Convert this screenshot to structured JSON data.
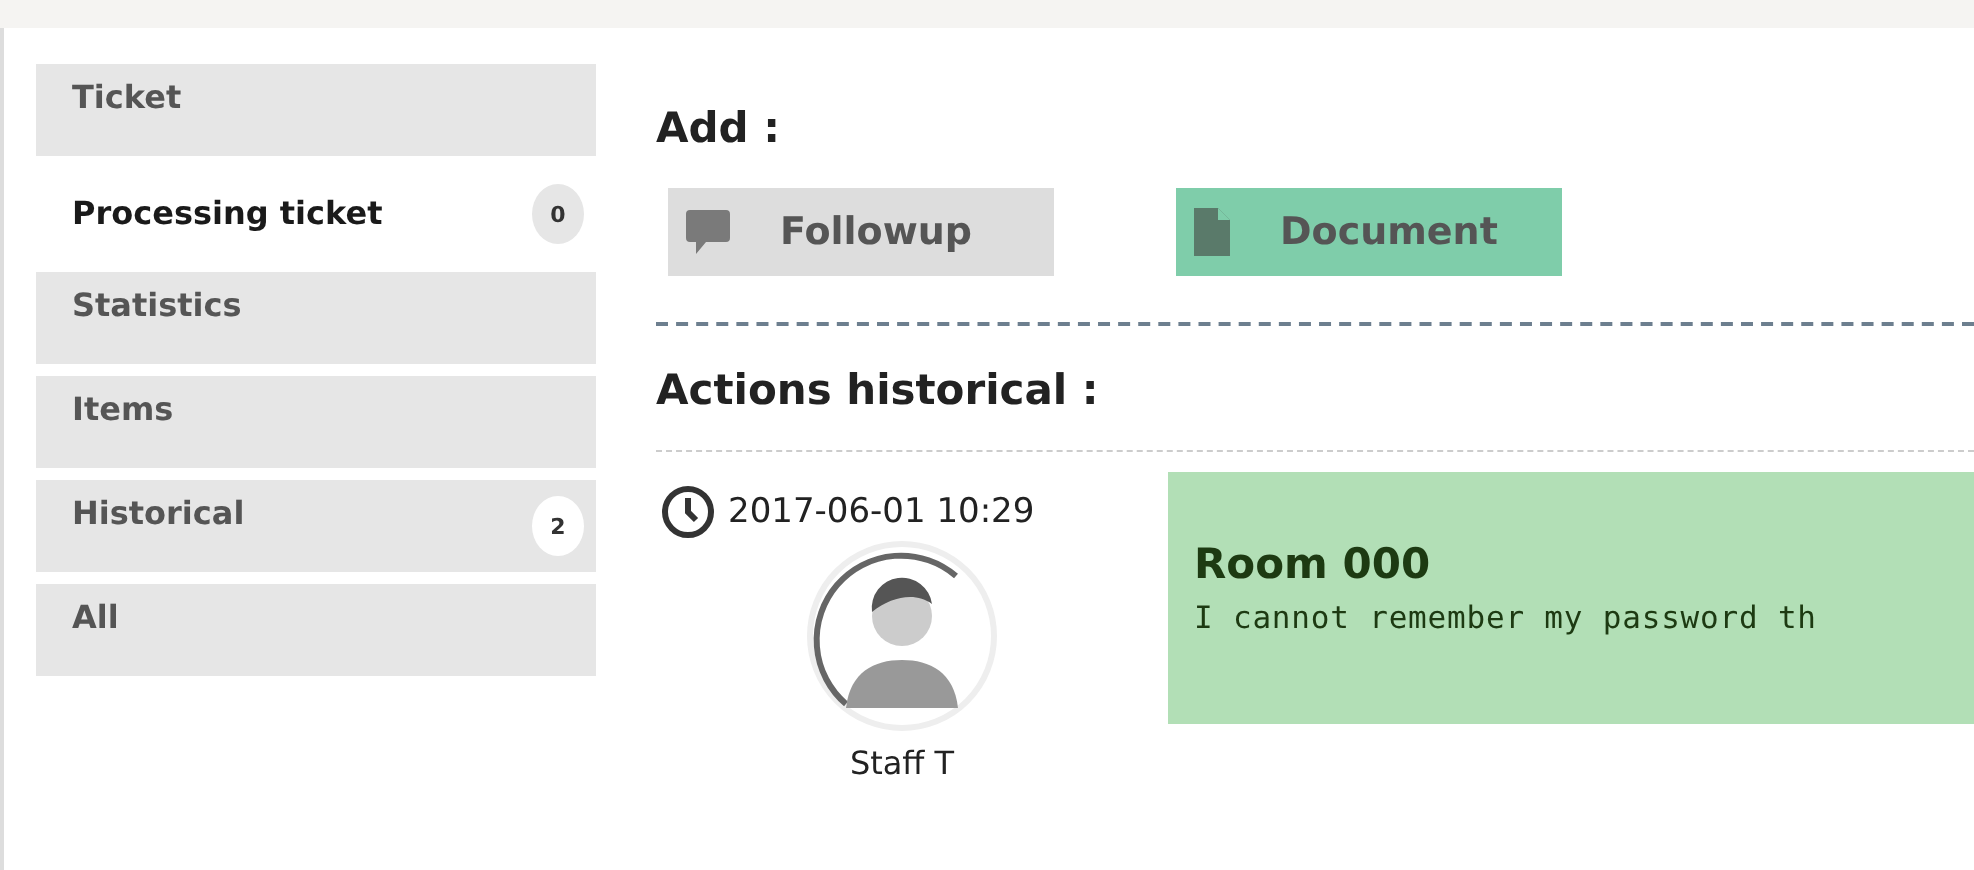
{
  "sidebar": {
    "items": [
      {
        "label": "Ticket",
        "selected": false
      },
      {
        "label": "Processing ticket",
        "selected": true,
        "count": "0"
      },
      {
        "label": "Statistics",
        "selected": false
      },
      {
        "label": "Items",
        "selected": false
      },
      {
        "label": "Historical",
        "selected": false,
        "count": "2"
      },
      {
        "label": "All",
        "selected": false
      }
    ]
  },
  "add": {
    "title": "Add :",
    "buttons": [
      {
        "label": "Followup",
        "kind": "comment",
        "color": "#dddddd"
      },
      {
        "label": "Document",
        "kind": "file",
        "color": "#7fcdaa"
      }
    ]
  },
  "history": {
    "title": "Actions historical :",
    "entries": [
      {
        "time": "2017-06-01 10:29",
        "author": "Staff T",
        "title": "Room 000",
        "text": "I cannot remember my password th"
      }
    ]
  }
}
